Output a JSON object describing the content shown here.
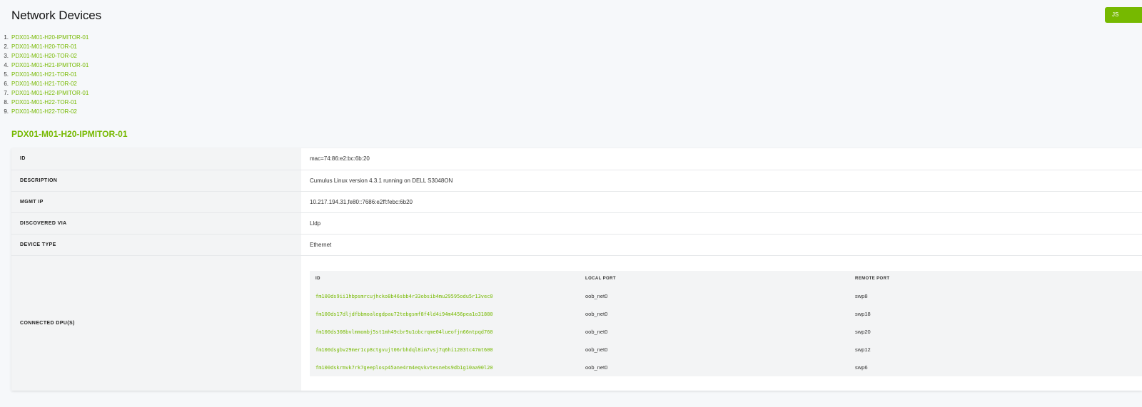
{
  "header": {
    "title": "Network Devices",
    "json_button_label": "JS"
  },
  "devices": [
    {
      "num": "1.",
      "name": "PDX01-M01-H20-IPMITOR-01"
    },
    {
      "num": "2.",
      "name": "PDX01-M01-H20-TOR-01"
    },
    {
      "num": "3.",
      "name": "PDX01-M01-H20-TOR-02"
    },
    {
      "num": "4.",
      "name": "PDX01-M01-H21-IPMITOR-01"
    },
    {
      "num": "5.",
      "name": "PDX01-M01-H21-TOR-01"
    },
    {
      "num": "6.",
      "name": "PDX01-M01-H21-TOR-02"
    },
    {
      "num": "7.",
      "name": "PDX01-M01-H22-IPMITOR-01"
    },
    {
      "num": "8.",
      "name": "PDX01-M01-H22-TOR-01"
    },
    {
      "num": "9.",
      "name": "PDX01-M01-H22-TOR-02"
    }
  ],
  "selected_device": {
    "title": "PDX01-M01-H20-IPMITOR-01",
    "fields": [
      {
        "label": "ID",
        "value": "mac=74:86:e2:bc:6b:20"
      },
      {
        "label": "DESCRIPTION",
        "value": "Cumulus Linux version 4.3.1 running on DELL S3048ON"
      },
      {
        "label": "MGMT IP",
        "value": "10.217.194.31,fe80::7686:e2ff:febc:6b20"
      },
      {
        "label": "DISCOVERED VIA",
        "value": "Lldp"
      },
      {
        "label": "DEVICE TYPE",
        "value": "Ethernet"
      }
    ],
    "connected_label": "CONNECTED DPU(S)",
    "dpu_table": {
      "headers": {
        "id": "ID",
        "local_port": "LOCAL PORT",
        "remote_port": "REMOTE PORT"
      },
      "rows": [
        {
          "id": "fm100ds9ii1hbpsmrcujhcko8b46sbb4r33obsib4mu29595odu5r13vec0",
          "local_port": "oob_net0",
          "remote_port": "swp8"
        },
        {
          "id": "fm100ds17dljdfbbmoalegdpau72tebgsmf8f4ld4i94m4456pea1o31880",
          "local_port": "oob_net0",
          "remote_port": "swp18"
        },
        {
          "id": "fm100ds308bvlmmombj5st1mh49cbr9u1obcrqme04lueofjn66ntpqd760",
          "local_port": "oob_net0",
          "remote_port": "swp20"
        },
        {
          "id": "fm100dsgbv29mer1cp8ctgvujt06rbhdql8im7vsj7q6hi1203tc47mt600",
          "local_port": "oob_net0",
          "remote_port": "swp12"
        },
        {
          "id": "fm100dskrmvk7rk7geeplosp45ane4rm4eqvkvtesnebs9db1g10aa90l20",
          "local_port": "oob_net0",
          "remote_port": "swp6"
        }
      ]
    }
  }
}
